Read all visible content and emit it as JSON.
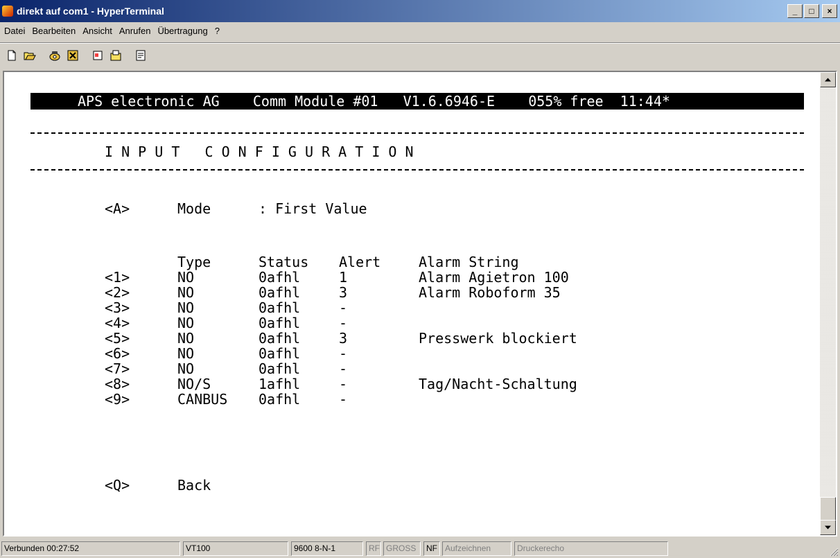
{
  "window": {
    "title": "direkt auf com1 - HyperTerminal",
    "buttons": {
      "minimize": "_",
      "maximize": "□",
      "close": "×"
    }
  },
  "menu": [
    "Datei",
    "Bearbeiten",
    "Ansicht",
    "Anrufen",
    "Übertragung",
    "?"
  ],
  "toolbar": {
    "icons": [
      "new-icon",
      "open-icon",
      "connect-icon",
      "disconnect-icon",
      "send-icon",
      "receive-icon",
      "properties-icon"
    ]
  },
  "terminal": {
    "header": "APS electronic AG    Comm Module #01   V1.6.6946-E    055% free  11:44*",
    "section_title": "I N P U T   C O N F I G U R A T I O N",
    "mode": {
      "key": "<A>",
      "label": "Mode",
      "value": ": First Value"
    },
    "columns": {
      "type": "Type",
      "status": "Status",
      "alert": "Alert",
      "alarm": "Alarm String"
    },
    "rows": [
      {
        "key": "<1>",
        "type": "NO",
        "status": "0afhl",
        "alert": "1",
        "alarm": "Alarm Agietron 100"
      },
      {
        "key": "<2>",
        "type": "NO",
        "status": "0afhl",
        "alert": "3",
        "alarm": "Alarm Roboform 35"
      },
      {
        "key": "<3>",
        "type": "NO",
        "status": "0afhl",
        "alert": "-",
        "alarm": ""
      },
      {
        "key": "<4>",
        "type": "NO",
        "status": "0afhl",
        "alert": "-",
        "alarm": ""
      },
      {
        "key": "<5>",
        "type": "NO",
        "status": "0afhl",
        "alert": "3",
        "alarm": "Presswerk blockiert"
      },
      {
        "key": "<6>",
        "type": "NO",
        "status": "0afhl",
        "alert": "-",
        "alarm": ""
      },
      {
        "key": "<7>",
        "type": "NO",
        "status": "0afhl",
        "alert": "-",
        "alarm": ""
      },
      {
        "key": "<8>",
        "type": "NO/S",
        "status": "1afhl",
        "alert": "-",
        "alarm": "Tag/Nacht-Schaltung"
      },
      {
        "key": "<9>",
        "type": "CANBUS",
        "status": "0afhl",
        "alert": "-",
        "alarm": ""
      }
    ],
    "back": {
      "key": "<Q>",
      "label": "Back"
    }
  },
  "statusbar": {
    "connected": "Verbunden 00:27:52",
    "emulation": "VT100",
    "settings": "9600 8-N-1",
    "rf": "RF",
    "gross": "GROSS",
    "nf": "NF",
    "capture": "Aufzeichnen",
    "print_echo": "Druckerecho"
  },
  "colors": {
    "titlebar_start": "#0a246a",
    "titlebar_end": "#a6caf0",
    "chrome": "#d4d0c8",
    "terminal_bg": "#ffffff",
    "terminal_fg": "#000000"
  }
}
